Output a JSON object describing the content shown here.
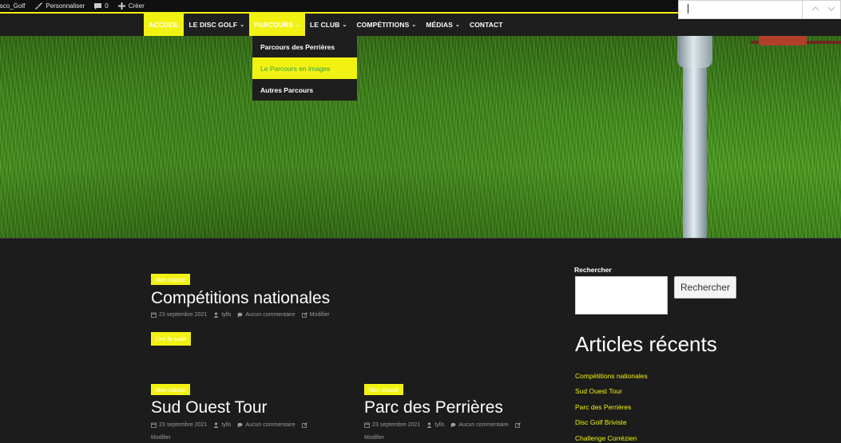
{
  "adminbar": {
    "site": "isco_Golf",
    "customize": "Personnaliser",
    "comments_count": "0",
    "create": "Créer"
  },
  "findbox": {
    "value": ""
  },
  "nav": {
    "items": [
      {
        "label": "ACCUEIL"
      },
      {
        "label": "LE DISC GOLF"
      },
      {
        "label": "PARCOURS"
      },
      {
        "label": "LE CLUB"
      },
      {
        "label": "COMPÉTITIONS"
      },
      {
        "label": "MÉDIAS"
      },
      {
        "label": "CONTACT"
      }
    ],
    "chevron": "⌄",
    "dropdown": [
      {
        "label": "Parcours des Perrières"
      },
      {
        "label": "Le Parcours en images"
      },
      {
        "label": "Autres Parcours"
      }
    ]
  },
  "posts": [
    {
      "badge": "Non classé",
      "title": "Compétitions nationales",
      "date": "23 septembre 2021",
      "author": "tylls",
      "comments": "Aucun commentaire",
      "edit": "Modifier",
      "readmore": "Lire la suite"
    },
    {
      "badge": "Non classé",
      "title": "Sud Ouest Tour",
      "date": "23 septembre 2021",
      "author": "tylls",
      "comments": "Aucun commentaire",
      "edit": "Modifier"
    },
    {
      "badge": "Non classé",
      "title": "Parc des Perrières",
      "date": "23 septembre 2021",
      "author": "tylls",
      "comments": "Aucun commentaire",
      "edit": "Modifier"
    }
  ],
  "sidebar": {
    "search_label": "Rechercher",
    "search_value": "",
    "search_button": "Rechercher",
    "recent_title": "Articles récents",
    "recent": [
      {
        "label": "Compétitions nationales"
      },
      {
        "label": "Sud Ouest Tour"
      },
      {
        "label": "Parc des Perrières"
      },
      {
        "label": "Disc Golf Briviste"
      },
      {
        "label": "Challenge Corrézien"
      }
    ]
  },
  "colors": {
    "accent": "#f2f212",
    "background": "#1c1c1c",
    "link_highlight": "#2ea04a"
  }
}
